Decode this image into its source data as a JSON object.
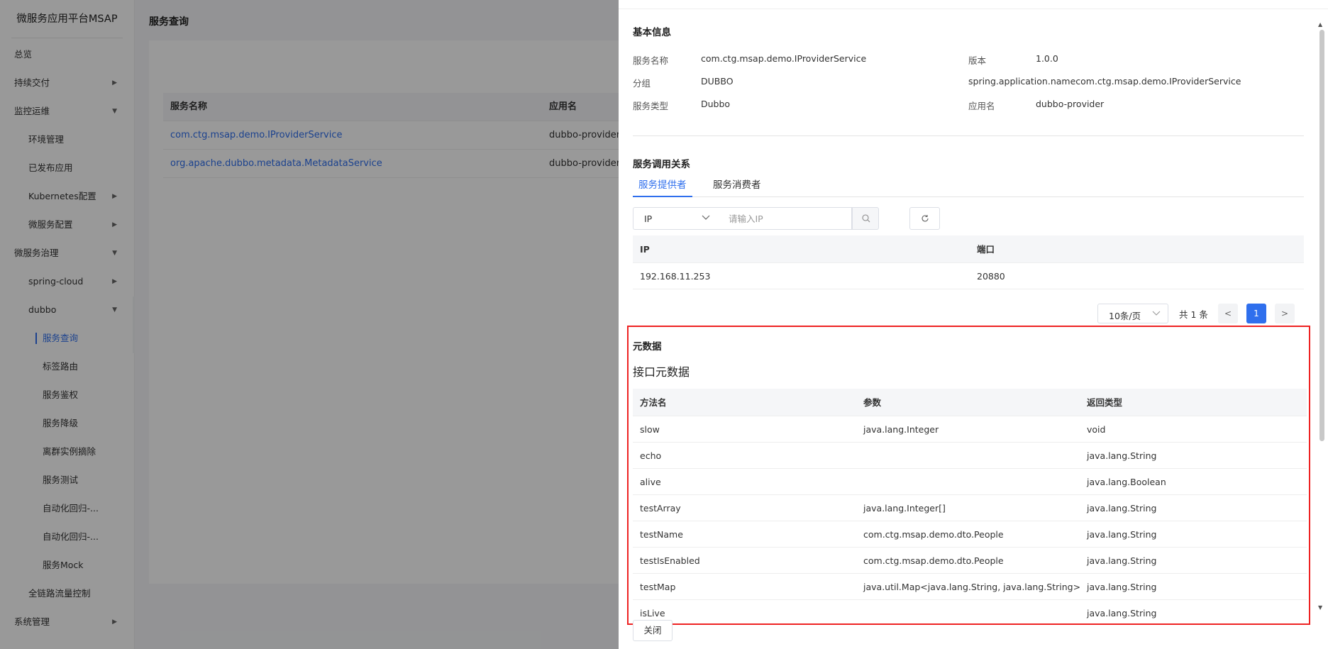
{
  "brand": "微服务应用平台MSAP",
  "sidebar": {
    "items": [
      {
        "label": "总览",
        "indent": 0,
        "arrow": ""
      },
      {
        "label": "持续交付",
        "indent": 0,
        "arrow": "▶"
      },
      {
        "label": "监控运维",
        "indent": 0,
        "arrow": "▼"
      },
      {
        "label": "环境管理",
        "indent": 1,
        "arrow": ""
      },
      {
        "label": "已发布应用",
        "indent": 1,
        "arrow": ""
      },
      {
        "label": "Kubernetes配置",
        "indent": 1,
        "arrow": "▶"
      },
      {
        "label": "微服务配置",
        "indent": 1,
        "arrow": "▶"
      },
      {
        "label": "微服务治理",
        "indent": 0,
        "arrow": "▼"
      },
      {
        "label": "spring-cloud",
        "indent": 1,
        "arrow": "▶"
      },
      {
        "label": "dubbo",
        "indent": 1,
        "arrow": "▼"
      },
      {
        "label": "服务查询",
        "indent": 2,
        "arrow": "",
        "active": true
      },
      {
        "label": "标签路由",
        "indent": 2,
        "arrow": ""
      },
      {
        "label": "服务鉴权",
        "indent": 2,
        "arrow": ""
      },
      {
        "label": "服务降级",
        "indent": 2,
        "arrow": ""
      },
      {
        "label": "离群实例摘除",
        "indent": 2,
        "arrow": ""
      },
      {
        "label": "服务测试",
        "indent": 2,
        "arrow": ""
      },
      {
        "label": "自动化回归-...",
        "indent": 2,
        "arrow": ""
      },
      {
        "label": "自动化回归-...",
        "indent": 2,
        "arrow": ""
      },
      {
        "label": "服务Mock",
        "indent": 2,
        "arrow": ""
      },
      {
        "label": "全链路流量控制",
        "indent": 1,
        "arrow": ""
      },
      {
        "label": "系统管理",
        "indent": 0,
        "arrow": "▶"
      }
    ]
  },
  "main": {
    "title": "服务查询",
    "table": {
      "headers": [
        "服务名称",
        "应用名"
      ],
      "rows": [
        [
          "com.ctg.msap.demo.IProviderService",
          "dubbo-provider"
        ],
        [
          "org.apache.dubbo.metadata.MetadataService",
          "dubbo-provider"
        ]
      ]
    }
  },
  "drawer": {
    "basic_title": "基本信息",
    "basic": {
      "service_name_label": "服务名称",
      "service_name": "com.ctg.msap.demo.IProviderService",
      "version_label": "版本",
      "version": "1.0.0",
      "group_label": "分组",
      "group": "DUBBO",
      "spring_app": "spring.application.namecom.ctg.msap.demo.IProviderService",
      "type_label": "服务类型",
      "type": "Dubbo",
      "app_label": "应用名",
      "app": "dubbo-provider"
    },
    "relation_title": "服务调用关系",
    "tabs": [
      "服务提供者",
      "服务消费者"
    ],
    "filter": {
      "select_value": "IP",
      "placeholder": "请输入IP"
    },
    "ip_table": {
      "headers": [
        "IP",
        "端口"
      ],
      "rows": [
        [
          "192.168.11.253",
          "20880"
        ]
      ]
    },
    "pager": {
      "page_size": "10条/页",
      "total": "共 1 条",
      "prev": "<",
      "current": "1",
      "next": ">"
    },
    "meta": {
      "title": "元数据",
      "subtitle": "接口元数据",
      "headers": [
        "方法名",
        "参数",
        "返回类型"
      ],
      "rows": [
        [
          "slow",
          "java.lang.Integer",
          "void"
        ],
        [
          "echo",
          "",
          "java.lang.String"
        ],
        [
          "alive",
          "",
          "java.lang.Boolean"
        ],
        [
          "testArray",
          "java.lang.Integer[]",
          "java.lang.String"
        ],
        [
          "testName",
          "com.ctg.msap.demo.dto.People",
          "java.lang.String"
        ],
        [
          "testIsEnabled",
          "com.ctg.msap.demo.dto.People",
          "java.lang.String"
        ],
        [
          "testMap",
          "java.util.Map<java.lang.String, java.lang.String>",
          "java.lang.String"
        ],
        [
          "isLive",
          "",
          "java.lang.String"
        ]
      ]
    },
    "close_label": "关闭"
  }
}
